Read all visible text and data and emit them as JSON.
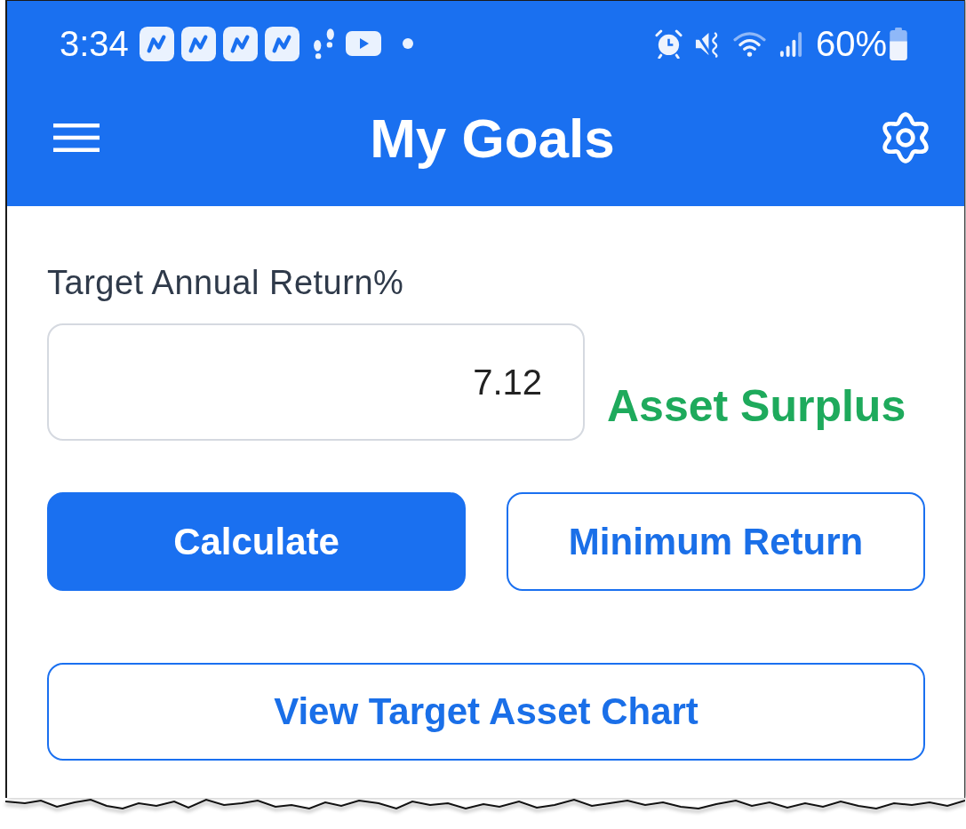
{
  "status_bar": {
    "time": "3:34",
    "battery": "60%"
  },
  "app_bar": {
    "title": "My Goals"
  },
  "target_return": {
    "label": "Target Annual Return%",
    "value": "7.12",
    "result": "Asset Surplus"
  },
  "buttons": [
    {
      "label": "Calculate",
      "kind": "primary"
    },
    {
      "label": "Minimum Return",
      "kind": "outline"
    }
  ],
  "chart_button": {
    "label": "View Target Asset Chart",
    "kind": "outline"
  }
}
